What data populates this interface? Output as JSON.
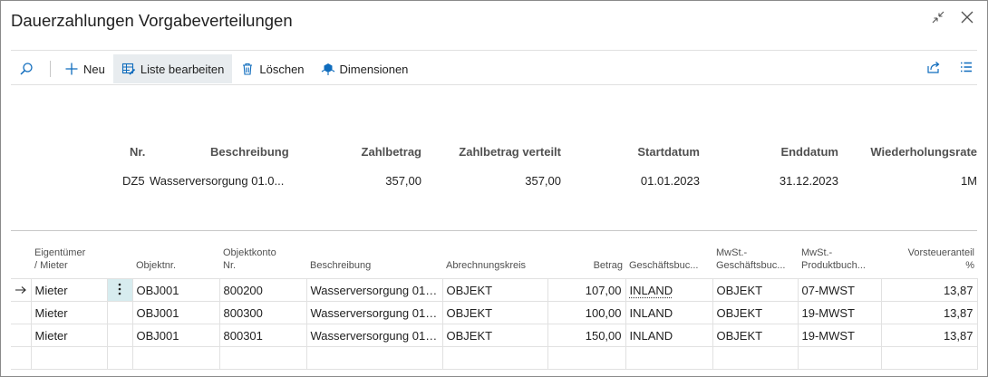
{
  "window": {
    "title": "Dauerzahlungen Vorgabeverteilungen"
  },
  "toolbar": {
    "new_label": "Neu",
    "edit_list_label": "Liste bearbeiten",
    "delete_label": "Löschen",
    "dimensions_label": "Dimensionen"
  },
  "header": {
    "columns": {
      "nr": "Nr.",
      "beschreibung": "Beschreibung",
      "zahlbetrag": "Zahlbetrag",
      "zahlbetrag_verteilt": "Zahlbetrag verteilt",
      "startdatum": "Startdatum",
      "enddatum": "Enddatum",
      "wiederholungsrate": "Wiederholungsrate"
    },
    "record": {
      "nr": "DZ5",
      "beschreibung": "Wasserversorgung 01.0...",
      "zahlbetrag": "357,00",
      "zahlbetrag_verteilt": "357,00",
      "startdatum": "01.01.2023",
      "enddatum": "31.12.2023",
      "wiederholungsrate": "1M"
    }
  },
  "lines": {
    "columns": {
      "eigentuemer_l1": "Eigentümer",
      "eigentuemer_l2": "/ Mieter",
      "objektnr": "Objektnr.",
      "objektkonto_l1": "Objektkonto",
      "objektkonto_l2": "Nr.",
      "beschreibung": "Beschreibung",
      "abrechnungskreis": "Abrechnungskreis",
      "betrag": "Betrag",
      "geschaeftsbuch": "Geschäftsbuc...",
      "mwst_gb_l1": "MwSt.-",
      "mwst_gb_l2": "Geschäftsbuc...",
      "mwst_pb_l1": "MwSt.-",
      "mwst_pb_l2": "Produktbuch...",
      "vorsteuer_l1": "Vorsteueranteil",
      "vorsteuer_l2": "%"
    },
    "rows": [
      {
        "eigentuemer": "Mieter",
        "objektnr": "OBJ001",
        "konto": "800200",
        "beschreibung": "Wasserversorgung 01....",
        "abrechnungskreis": "OBJEKT",
        "betrag": "107,00",
        "gb": "INLAND",
        "mwst_gb": "OBJEKT",
        "mwst_pb": "07-MWST",
        "vorsteuer": "13,87"
      },
      {
        "eigentuemer": "Mieter",
        "objektnr": "OBJ001",
        "konto": "800300",
        "beschreibung": "Wasserversorgung 01....",
        "abrechnungskreis": "OBJEKT",
        "betrag": "100,00",
        "gb": "INLAND",
        "mwst_gb": "OBJEKT",
        "mwst_pb": "19-MWST",
        "vorsteuer": "13,87"
      },
      {
        "eigentuemer": "Mieter",
        "objektnr": "OBJ001",
        "konto": "800301",
        "beschreibung": "Wasserversorgung 01....",
        "abrechnungskreis": "OBJEKT",
        "betrag": "150,00",
        "gb": "INLAND",
        "mwst_gb": "OBJEKT",
        "mwst_pb": "19-MWST",
        "vorsteuer": "13,87"
      }
    ]
  },
  "icons": {
    "search": "search-icon",
    "plus": "plus-icon",
    "edit_list": "edit-list-icon",
    "delete": "trash-icon",
    "dimensions": "dimensions-icon",
    "share": "share-icon",
    "list": "list-icon",
    "collapse": "collapse-icon",
    "close": "close-icon",
    "row_arrow": "row-arrow-icon",
    "row_menu": "more-vertical-icon"
  },
  "colors": {
    "accent": "#0f6cbd",
    "active_tool": "#e8ecef",
    "menu_cell": "#d7ecef"
  }
}
